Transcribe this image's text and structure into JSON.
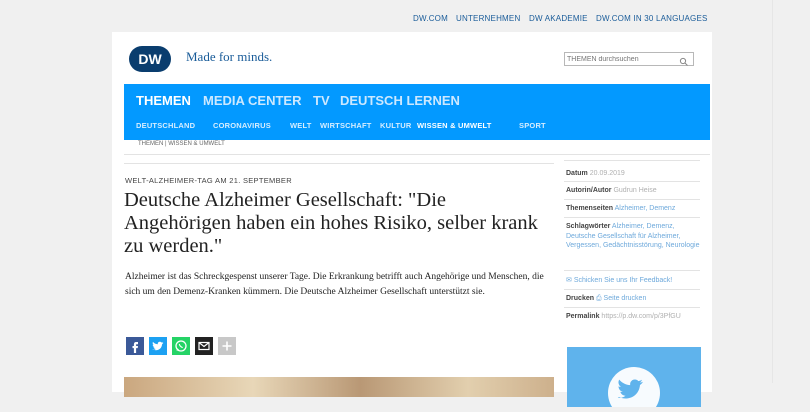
{
  "topbar": {
    "links": [
      "DW.COM",
      "UNTERNEHMEN",
      "DW AKADEMIE",
      "DW.COM IN 30 LANGUAGES"
    ]
  },
  "header": {
    "logo_text": "DW",
    "tagline": "Made for minds.",
    "search_placeholder": "THEMEN durchsuchen"
  },
  "nav": {
    "main": [
      "THEMEN",
      "MEDIA CENTER",
      "TV",
      "DEUTSCH LERNEN"
    ],
    "sub": [
      "DEUTSCHLAND",
      "CORONAVIRUS",
      "WELT",
      "WIRTSCHAFT",
      "KULTUR",
      "WISSEN & UMWELT",
      "SPORT"
    ]
  },
  "breadcrumb": "THEMEN | WISSEN & UMWELT",
  "article": {
    "kicker": "WELT-ALZHEIMER-TAG AM 21. SEPTEMBER",
    "headline": "Deutsche Alzheimer Gesellschaft: \"Die Angehörigen haben ein hohes Risiko, selber krank zu werden.\"",
    "teaser": "Alzheimer ist das Schreckgespenst unserer Tage. Die Erkrankung betrifft auch Angehörige und Menschen, die sich um den Demenz-Kranken kümmern. Die Deutsche Alzheimer Gesellschaft unterstützt sie."
  },
  "share": {
    "icons": [
      "facebook-icon",
      "twitter-icon",
      "whatsapp-icon",
      "email-icon",
      "more-icon"
    ],
    "colors": [
      "#3b5998",
      "#1da1f2",
      "#25d366",
      "#222222",
      "#c8c8c8"
    ]
  },
  "sidebar": {
    "date_label": "Datum",
    "date_value": "20.09.2019",
    "author_label": "Autorin/Autor",
    "author_value": "Gudrun Heise",
    "topics_label": "Themenseiten",
    "topics_value": "Alzheimer, Demenz",
    "tags_label": "Schlagwörter",
    "tags_value": "Alzheimer, Demenz, Deutsche Gesellschaft für Alzheimer, Vergessen, Gedächtnisstörung, Neurologie",
    "feedback": "Schicken Sie uns Ihr Feedback!",
    "print_label": "Drucken",
    "print_value": "Seite drucken",
    "permalink_label": "Permalink",
    "permalink_value": "https://p.dw.com/p/3PfGU"
  },
  "colors": {
    "brand_blue": "#0399ff",
    "link_blue": "#1a5c99",
    "background": "#f0f0f0"
  }
}
